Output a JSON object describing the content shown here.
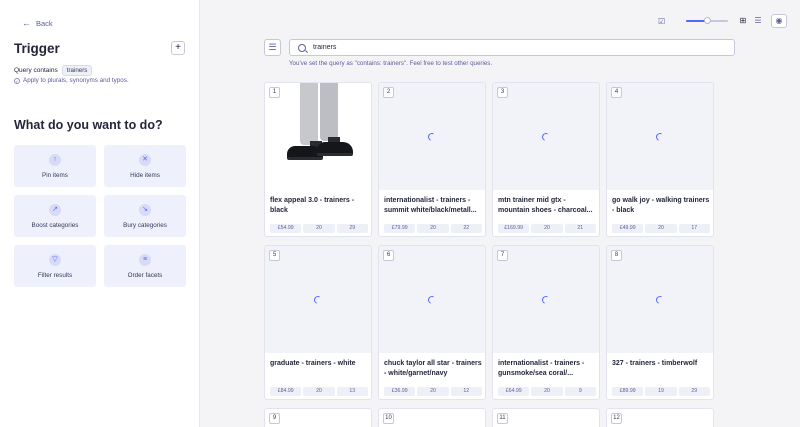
{
  "sidebar": {
    "back_label": "Back",
    "title": "Trigger",
    "add_label": "+",
    "query_prefix": "Query contains",
    "query_chip": "trainers",
    "apply_note": "Apply to plurals, synonyms and typos.",
    "section_title": "What do you want to do?",
    "actions": [
      {
        "label": "Pin items",
        "icon": "pin-icon"
      },
      {
        "label": "Hide items",
        "icon": "hide-icon"
      },
      {
        "label": "Boost categories",
        "icon": "boost-icon"
      },
      {
        "label": "Bury categories",
        "icon": "bury-icon"
      },
      {
        "label": "Filter results",
        "icon": "filter-icon"
      },
      {
        "label": "Order facets",
        "icon": "order-icon"
      }
    ]
  },
  "toolbar": {
    "zoom_level": 0.5,
    "view_mode": "grid",
    "icons": [
      "checklist-icon",
      "grid-view-icon",
      "list-view-icon",
      "eye-icon"
    ]
  },
  "search": {
    "value": "trainers",
    "hint": "You've set the query as \"contains: trainers\". Feel free to test other queries."
  },
  "results": [
    {
      "num": "1",
      "title": "flex appeal 3.0 - trainers - black",
      "price": "£54.99",
      "a": "20",
      "b": "29",
      "loading": false
    },
    {
      "num": "2",
      "title": "internationalist - trainers - summit white/black/metall...",
      "price": "£79.99",
      "a": "20",
      "b": "22",
      "loading": true
    },
    {
      "num": "3",
      "title": "mtn trainer mid gtx - mountain shoes - charcoal...",
      "price": "£169.99",
      "a": "20",
      "b": "21",
      "loading": true
    },
    {
      "num": "4",
      "title": "go walk joy - walking trainers - black",
      "price": "£49.99",
      "a": "20",
      "b": "17",
      "loading": true
    },
    {
      "num": "5",
      "title": "graduate - trainers - white",
      "price": "£84.99",
      "a": "20",
      "b": "13",
      "loading": true
    },
    {
      "num": "6",
      "title": "chuck taylor all star - trainers - white/garnet/navy",
      "price": "£36.99",
      "a": "20",
      "b": "12",
      "loading": true
    },
    {
      "num": "7",
      "title": "internationalist - trainers - gunsmoke/sea coral/...",
      "price": "£64.99",
      "a": "20",
      "b": "9",
      "loading": true
    },
    {
      "num": "8",
      "title": "327 - trainers - timberwolf",
      "price": "£89.99",
      "a": "19",
      "b": "29",
      "loading": true
    },
    {
      "num": "9"
    },
    {
      "num": "10"
    },
    {
      "num": "11"
    },
    {
      "num": "12"
    }
  ]
}
